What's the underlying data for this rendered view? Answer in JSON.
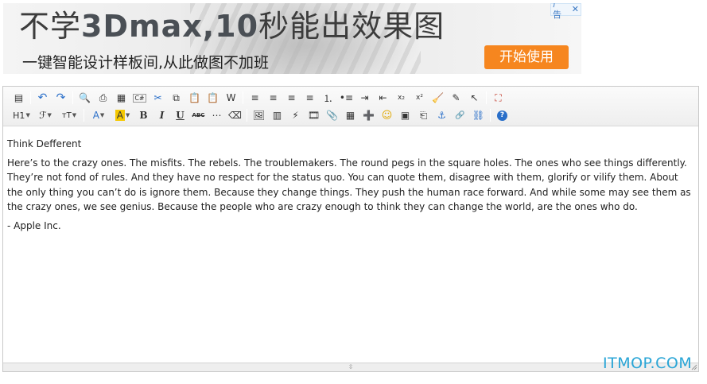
{
  "ad": {
    "headline_prefix": "不学",
    "headline_bold": "3Dmax,10",
    "headline_suffix": "秒能出效果图",
    "subline": "一键智能设计样板间,从此做图不加班",
    "cta": "开始使用",
    "label": "广告",
    "close": "✕"
  },
  "toolbar": {
    "row1": [
      {
        "name": "source-icon",
        "glyph": "▤"
      },
      {
        "sep": true
      },
      {
        "name": "undo-icon",
        "glyph": "↶"
      },
      {
        "name": "redo-icon",
        "glyph": "↷"
      },
      {
        "sep": true
      },
      {
        "name": "preview-icon",
        "glyph": "🔍"
      },
      {
        "name": "print-icon",
        "glyph": "⎙"
      },
      {
        "name": "templates-icon",
        "glyph": "▦"
      },
      {
        "name": "code-icon",
        "glyph": "C#"
      },
      {
        "name": "cut-icon",
        "glyph": "✂"
      },
      {
        "name": "copy-icon",
        "glyph": "⧉"
      },
      {
        "name": "paste-icon",
        "glyph": "📋"
      },
      {
        "name": "paste-text-icon",
        "glyph": "📋"
      },
      {
        "name": "paste-word-icon",
        "glyph": "W"
      },
      {
        "sep": true
      },
      {
        "name": "align-left-icon",
        "glyph": "≡"
      },
      {
        "name": "align-center-icon",
        "glyph": "≡"
      },
      {
        "name": "align-right-icon",
        "glyph": "≡"
      },
      {
        "name": "align-justify-icon",
        "glyph": "≡"
      },
      {
        "name": "ordered-list-icon",
        "glyph": "⒈"
      },
      {
        "name": "unordered-list-icon",
        "glyph": "•≡"
      },
      {
        "name": "indent-icon",
        "glyph": "⇥"
      },
      {
        "name": "outdent-icon",
        "glyph": "⇤"
      },
      {
        "name": "subscript-icon",
        "glyph": "x₂"
      },
      {
        "name": "superscript-icon",
        "glyph": "x²"
      },
      {
        "name": "clear-format-icon",
        "glyph": "🧹"
      },
      {
        "name": "spellcheck-icon",
        "glyph": "✎"
      },
      {
        "name": "select-all-icon",
        "glyph": "↖"
      },
      {
        "sep": true
      },
      {
        "name": "fullscreen-icon",
        "glyph": "⛶"
      }
    ],
    "row2": [
      {
        "name": "heading-button",
        "glyph": "H1",
        "dropdown": true
      },
      {
        "name": "font-family-button",
        "glyph": "ℱ",
        "dropdown": true
      },
      {
        "name": "font-size-button",
        "glyph": "тT",
        "dropdown": true
      },
      {
        "sep": true
      },
      {
        "name": "font-color-button",
        "glyph": "A",
        "dropdown": true
      },
      {
        "name": "highlight-button",
        "glyph": "A",
        "dropdown": true
      },
      {
        "name": "bold-icon",
        "glyph": "B"
      },
      {
        "name": "italic-icon",
        "glyph": "I"
      },
      {
        "name": "underline-icon",
        "glyph": "U"
      },
      {
        "name": "strikethrough-icon",
        "glyph": "ABC"
      },
      {
        "name": "horizontal-rule-icon",
        "glyph": "⋯"
      },
      {
        "name": "eraser-icon",
        "glyph": "⌫"
      },
      {
        "sep": true
      },
      {
        "name": "image-icon",
        "glyph": "🖼"
      },
      {
        "name": "multi-image-icon",
        "glyph": "▥"
      },
      {
        "name": "flash-icon",
        "glyph": "⚡"
      },
      {
        "name": "media-icon",
        "glyph": "🎞"
      },
      {
        "name": "attachment-icon",
        "glyph": "📎"
      },
      {
        "name": "table-icon",
        "glyph": "▦"
      },
      {
        "name": "insert-row-icon",
        "glyph": "➕"
      },
      {
        "name": "emoticon-icon",
        "glyph": "☺"
      },
      {
        "name": "map-icon",
        "glyph": "▣"
      },
      {
        "name": "page-break-icon",
        "glyph": "⎗"
      },
      {
        "name": "anchor-icon",
        "glyph": "⚓"
      },
      {
        "name": "link-icon",
        "glyph": "🔗"
      },
      {
        "name": "unlink-icon",
        "glyph": "⛓"
      },
      {
        "sep": true
      },
      {
        "name": "help-icon",
        "glyph": "?"
      }
    ]
  },
  "content": {
    "title": "Think Defferent",
    "body": "Here’s to the crazy ones. The misfits. The rebels. The troublemakers. The round pegs in the square holes. The ones who see things differently. They’re not fond of rules. And they have no respect for the status quo. You can quote them, disagree with them, glorify or vilify them. About the only thing you can’t do is ignore them. Because they change things. They push the human race forward. And while some may see them as the crazy ones, we see genius. Because the people who are crazy enough to think they can change the world, are the ones who do.",
    "signature": "- Apple Inc."
  },
  "statusbar": {
    "grip": "⇳"
  },
  "watermark": "ITMOP.COM",
  "colors": {
    "cta": "#f6861f",
    "watermark": "#29a5d6",
    "toolbar_bg": "#f3f3f3",
    "border": "#c9c9c9"
  }
}
